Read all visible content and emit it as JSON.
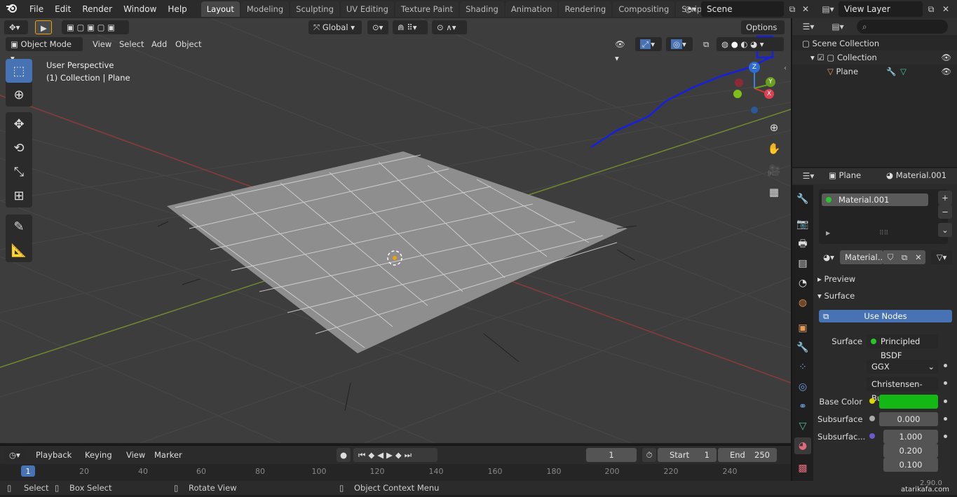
{
  "topbar": {
    "menu": [
      "File",
      "Edit",
      "Render",
      "Window",
      "Help"
    ],
    "workspaces": [
      "Layout",
      "Modeling",
      "Sculpting",
      "UV Editing",
      "Texture Paint",
      "Shading",
      "Animation",
      "Rendering",
      "Compositing",
      "Scripting"
    ],
    "active_workspace": "Layout",
    "scene": "Scene",
    "view_layer": "View Layer"
  },
  "viewport": {
    "transform_orientation": "Global",
    "options_label": "Options",
    "mode": "Object Mode",
    "menus": [
      "View",
      "Select",
      "Add",
      "Object"
    ],
    "overlay_title": "User Perspective",
    "overlay_sub": "(1) Collection | Plane",
    "gizmo": {
      "x": "X",
      "y": "Y",
      "z": "Z"
    }
  },
  "outliner": {
    "scene_collection": "Scene Collection",
    "collection": "Collection",
    "object": "Plane"
  },
  "properties": {
    "object_name": "Plane",
    "material_name": "Material.001",
    "slot_name": "Material.001",
    "datablock_name": "Material...",
    "preview_label": "Preview",
    "surface_label": "Surface",
    "use_nodes_label": "Use Nodes",
    "surface_field_label": "Surface",
    "surface_shader": "Principled BSDF",
    "distribution": "GGX",
    "subsurface_method": "Christensen-Bu...",
    "base_color_label": "Base Color",
    "base_color": "#14b814",
    "subsurface_label": "Subsurface",
    "subsurface_value": "0.000",
    "subsurface_radius_label": "Subsurfac...",
    "subsurface_radius": [
      "1.000",
      "0.200",
      "0.100"
    ]
  },
  "timeline": {
    "menus": [
      "Playback",
      "Keying",
      "View",
      "Marker"
    ],
    "current_frame": "1",
    "start_label": "Start",
    "start_value": "1",
    "end_label": "End",
    "end_value": "250",
    "ruler_ticks": [
      "1",
      "20",
      "40",
      "60",
      "80",
      "100",
      "120",
      "140",
      "160",
      "180",
      "200",
      "220",
      "240"
    ]
  },
  "statusbar": {
    "select": "Select",
    "box_select": "Box Select",
    "rotate_view": "Rotate View",
    "context_menu": "Object Context Menu",
    "version": "2.90.0",
    "watermark": "atarikafa.com"
  }
}
